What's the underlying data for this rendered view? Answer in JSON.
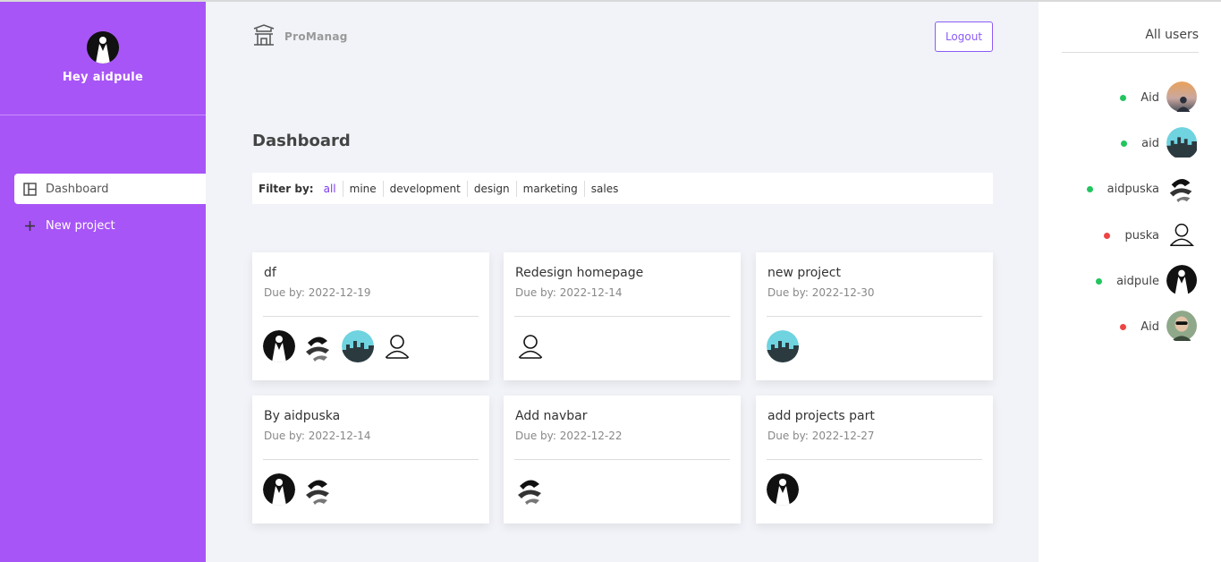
{
  "sidebar": {
    "greeting": "Hey aidpule",
    "nav": [
      {
        "label": "Dashboard",
        "icon": "layout-icon",
        "active": true
      },
      {
        "label": "New project",
        "icon": "plus-icon",
        "active": false
      }
    ]
  },
  "header": {
    "brand": "ProManag",
    "logout_label": "Logout"
  },
  "main": {
    "title": "Dashboard",
    "filter": {
      "label": "Filter by:",
      "options": [
        "all",
        "mine",
        "development",
        "design",
        "marketing",
        "sales"
      ],
      "selected": "all"
    },
    "projects": [
      {
        "title": "df",
        "due": "Due by: 2022-12-19",
        "members": [
          "tuxedo",
          "abstract",
          "city",
          "outline"
        ]
      },
      {
        "title": "Redesign homepage",
        "due": "Due by: 2022-12-14",
        "members": [
          "outline"
        ]
      },
      {
        "title": "new project",
        "due": "Due by: 2022-12-30",
        "members": [
          "city"
        ]
      },
      {
        "title": "By aidpuska",
        "due": "Due by: 2022-12-14",
        "members": [
          "tuxedo",
          "abstract"
        ]
      },
      {
        "title": "Add navbar",
        "due": "Due by: 2022-12-22",
        "members": [
          "abstract"
        ]
      },
      {
        "title": "add projects part",
        "due": "Due by: 2022-12-27",
        "members": [
          "tuxedo"
        ]
      }
    ]
  },
  "users_panel": {
    "title": "All users",
    "users": [
      {
        "name": "Aid",
        "status": "online",
        "avatar": "sunset"
      },
      {
        "name": "aid",
        "status": "online",
        "avatar": "city"
      },
      {
        "name": "aidpuska",
        "status": "online",
        "avatar": "abstract"
      },
      {
        "name": "puska",
        "status": "offline",
        "avatar": "outline"
      },
      {
        "name": "aidpule",
        "status": "online",
        "avatar": "tuxedo"
      },
      {
        "name": "Aid",
        "status": "offline",
        "avatar": "portrait"
      }
    ]
  },
  "colors": {
    "sidebar": "#a855f7",
    "accent": "#7c3aed",
    "online": "#22c55e",
    "offline": "#ef4444"
  }
}
